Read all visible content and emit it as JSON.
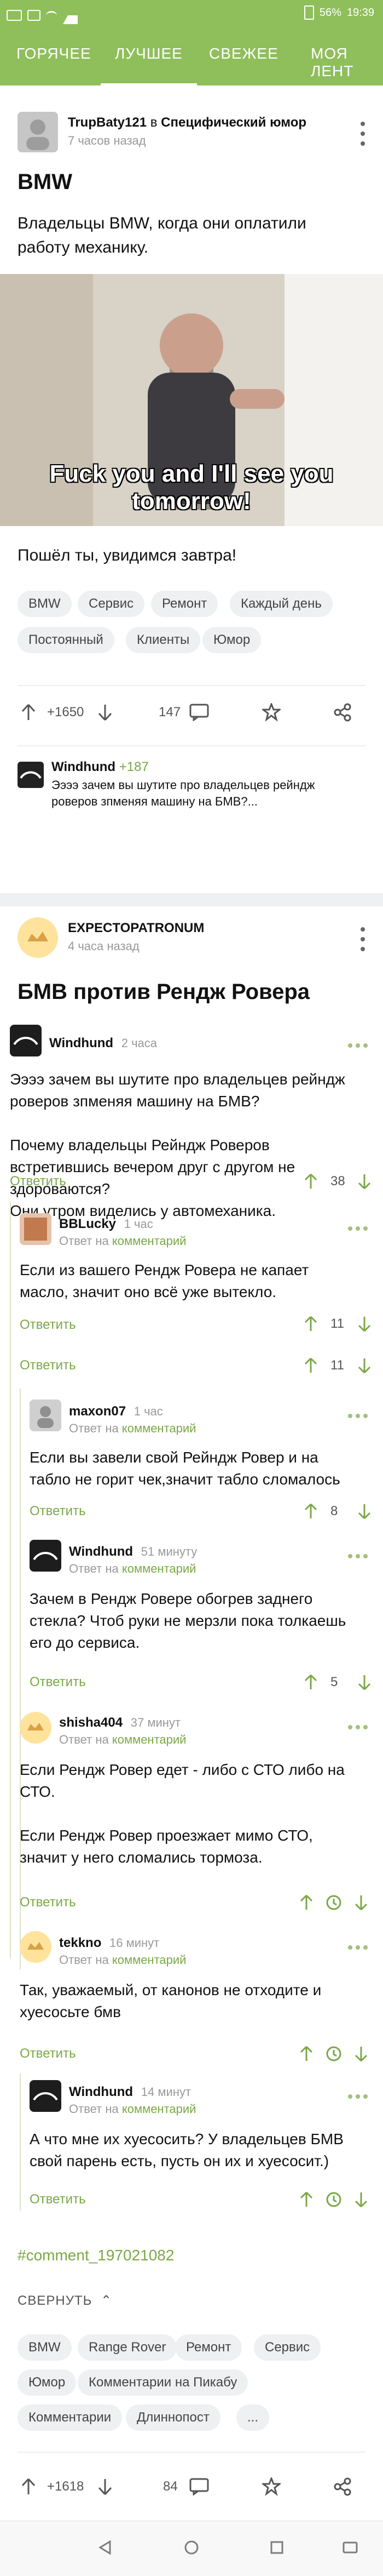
{
  "status_bar": {
    "battery": "56%",
    "time": "19:39"
  },
  "tabs": [
    {
      "label": "ГОРЯЧЕЕ"
    },
    {
      "label": "ЛУЧШЕЕ"
    },
    {
      "label": "СВЕЖЕЕ"
    },
    {
      "label": "МОЯ ЛЕНТ"
    }
  ],
  "post1": {
    "author": "TrupBaty121",
    "in": "в",
    "community": "Специфический юмор",
    "time": "7 часов назад",
    "title": "BMW",
    "text": "Владельцы BMW, когда они оплатили работу механику.",
    "image_caption": "Fuck you and I'll see you tomorrow!",
    "subtext": "Пошёл ты, увидимся завтра!",
    "tags": [
      "BMW",
      "Сервис",
      "Ремонт",
      "Каждый день",
      "Постоянный",
      "Клиенты",
      "Юмор"
    ],
    "rating": "+1650",
    "comments": "147",
    "top_comment": {
      "author": "Windhund",
      "rating": "+187",
      "text": "Ээээ зачем вы шутите про владельцев рейндж роверов зпменяя машину на БМВ?..."
    }
  },
  "post2": {
    "author": "EXPECTOPATRONUM",
    "time": "4 часа назад",
    "title": "БМВ против Рендж Ровера",
    "comment_anchor": "#comment_197021082",
    "collapse": "СВЕРНУТЬ",
    "tags": [
      "BMW",
      "Range Rover",
      "Ремонт",
      "Сервис",
      "Юмор",
      "Комментарии на Пикабу",
      "Комментарии",
      "Длиннопост",
      "..."
    ],
    "rating": "+1618",
    "comments": "84"
  },
  "comments": [
    {
      "author": "Windhund",
      "time": "2 часа",
      "text": "Ээээ зачем вы шутите про владельцев рейндж роверов зпменяя машину на БМВ?\n\nПочему владельцы Рейндж Роверов встретившись вечером друг с другом не здороваются?\nОни утром виделись у автомеханика.",
      "reply": "Ответить",
      "rating": "38"
    },
    {
      "author": "BBLucky",
      "time": "1 час",
      "sub": "Ответ на",
      "sub_link": "комментарий",
      "text": "Если из вашего Рендж Ровера не капает масло, значит оно всё уже вытекло.",
      "reply": "Ответить",
      "rating": "11",
      "reply2": "Ответить",
      "rating2": "11"
    },
    {
      "author": "maxon07",
      "time": "1 час",
      "sub": "Ответ на",
      "sub_link": "комментарий",
      "text": "Если вы завели свой Рейндж Ровер и на табло не горит чек,значит табло сломалось",
      "reply": "Ответить",
      "rating": "8"
    },
    {
      "author": "Windhund",
      "time": "51 минуту",
      "sub": "Ответ на",
      "sub_link": "комментарий",
      "text": "Зачем в Рендж Ровере обогрев заднего стекла? Чтоб руки не мерзли пока толкаешь его до сервиса.",
      "reply": "Ответить",
      "rating": "5"
    },
    {
      "author": "shisha404",
      "time": "37 минут",
      "sub": "Ответ на",
      "sub_link": "комментарий",
      "text": "Если Рендж Ровер едет - либо с СТО либо на СТО.\n\nЕсли Рендж Ровер проезжает мимо СТО, значит у него сломались тормоза.",
      "reply": "Ответить"
    },
    {
      "author": "tekkno",
      "time": "16 минут",
      "sub": "Ответ на",
      "sub_link": "комментарий",
      "text": "Так, уважаемый, от канонов не отходите и хуесосьте бмв",
      "reply": "Ответить"
    },
    {
      "author": "Windhund",
      "time": "14 минут",
      "sub": "Ответ на",
      "sub_link": "комментарий",
      "text": "А что мне их хуесосить? У владельцев БМВ свой парень есть, пусть он их и хуесосит.)",
      "reply": "Ответить"
    }
  ]
}
